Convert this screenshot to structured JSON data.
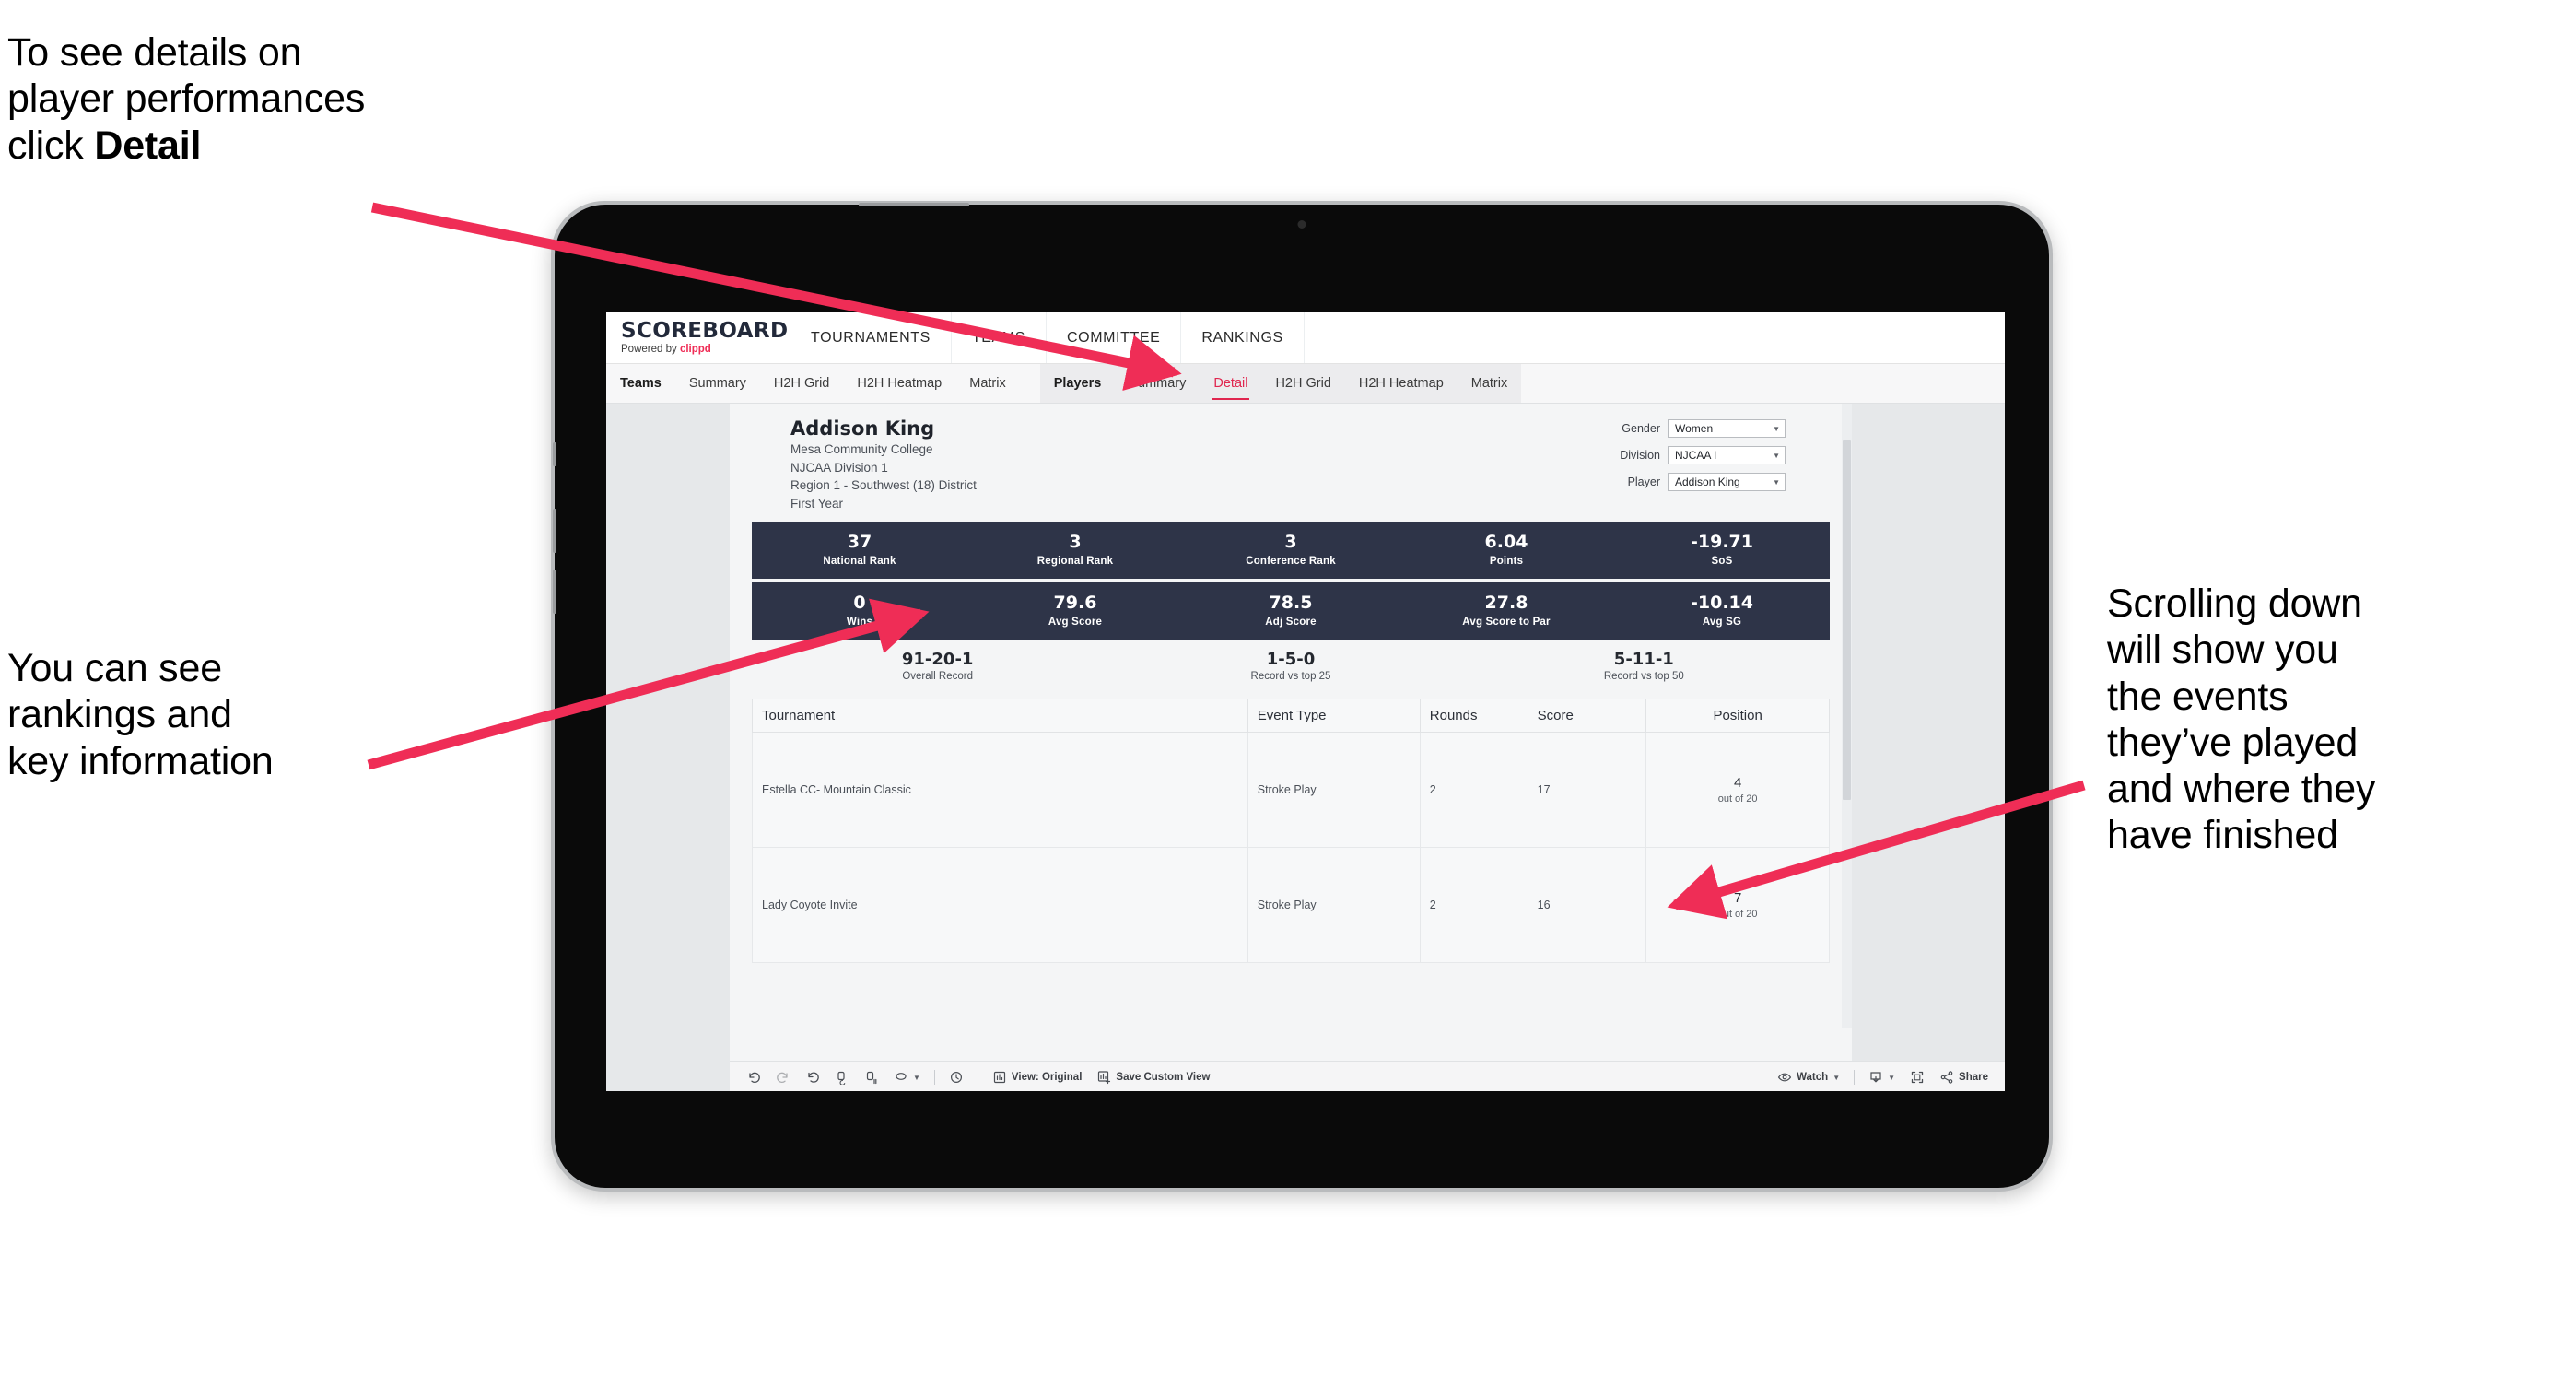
{
  "annotations": {
    "top_left_plain": "To see details on\nplayer performances\nclick ",
    "top_left_bold": "Detail",
    "mid_left": "You can see\nrankings and\nkey information",
    "right": "Scrolling down\nwill show you\nthe events\nthey’ve played\nand where they\nhave finished",
    "arrow_color": "#ef2d56"
  },
  "app": {
    "brand": {
      "title": "SCOREBOARD",
      "powered_prefix": "Powered by ",
      "powered_name": "clippd"
    },
    "top_nav": [
      "TOURNAMENTS",
      "TEAMS",
      "COMMITTEE",
      "RANKINGS"
    ],
    "tab_bar": {
      "group1_label": "Teams",
      "group1": [
        "Summary",
        "H2H Grid",
        "H2H Heatmap",
        "Matrix"
      ],
      "group2_label": "Players",
      "group2": [
        "Summary",
        "Detail",
        "H2H Grid",
        "H2H Heatmap",
        "Matrix"
      ],
      "active_tab": "Detail"
    }
  },
  "player": {
    "name": "Addison King",
    "college": "Mesa Community College",
    "division": "NJCAA Division 1",
    "region": "Region 1 - Southwest (18) District",
    "year": "First Year"
  },
  "filters": [
    {
      "label": "Gender",
      "value": "Women"
    },
    {
      "label": "Division",
      "value": "NJCAA I"
    },
    {
      "label": "Player",
      "value": "Addison King"
    }
  ],
  "stat_band_1": [
    {
      "value": "37",
      "label": "National Rank"
    },
    {
      "value": "3",
      "label": "Regional Rank"
    },
    {
      "value": "3",
      "label": "Conference Rank"
    },
    {
      "value": "6.04",
      "label": "Points"
    },
    {
      "value": "-19.71",
      "label": "SoS"
    }
  ],
  "stat_band_2": [
    {
      "value": "0",
      "label": "Wins"
    },
    {
      "value": "79.6",
      "label": "Avg Score"
    },
    {
      "value": "78.5",
      "label": "Adj Score"
    },
    {
      "value": "27.8",
      "label": "Avg Score to Par"
    },
    {
      "value": "-10.14",
      "label": "Avg SG"
    }
  ],
  "records": [
    {
      "value": "91-20-1",
      "label": "Overall Record"
    },
    {
      "value": "1-5-0",
      "label": "Record vs top 25"
    },
    {
      "value": "5-11-1",
      "label": "Record vs top 50"
    }
  ],
  "events_table": {
    "columns": [
      "Tournament",
      "Event Type",
      "Rounds",
      "Score",
      "Position"
    ],
    "rows": [
      {
        "tournament": "Estella CC- Mountain Classic",
        "event_type": "Stroke Play",
        "rounds": "2",
        "score": "17",
        "position": "4",
        "position_of": "out of 20"
      },
      {
        "tournament": "Lady Coyote Invite",
        "event_type": "Stroke Play",
        "rounds": "2",
        "score": "16",
        "position": "7",
        "position_of": "out of 20"
      }
    ]
  },
  "toolbar": {
    "view_label": "View: Original",
    "save_label": "Save Custom View",
    "watch_label": "Watch",
    "share_label": "Share"
  }
}
